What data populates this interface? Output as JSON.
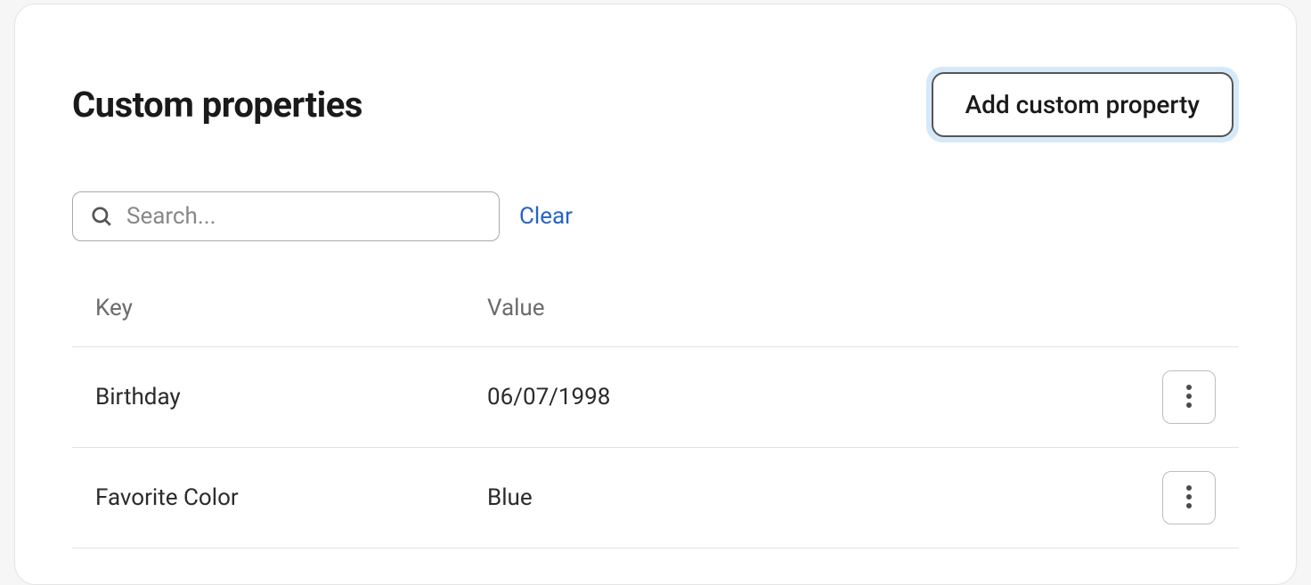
{
  "header": {
    "title": "Custom properties",
    "add_button_label": "Add custom property"
  },
  "search": {
    "placeholder": "Search...",
    "value": "",
    "clear_label": "Clear"
  },
  "table": {
    "columns": {
      "key": "Key",
      "value": "Value"
    },
    "rows": [
      {
        "key": "Birthday",
        "value": "06/07/1998"
      },
      {
        "key": "Favorite Color",
        "value": "Blue"
      }
    ]
  }
}
